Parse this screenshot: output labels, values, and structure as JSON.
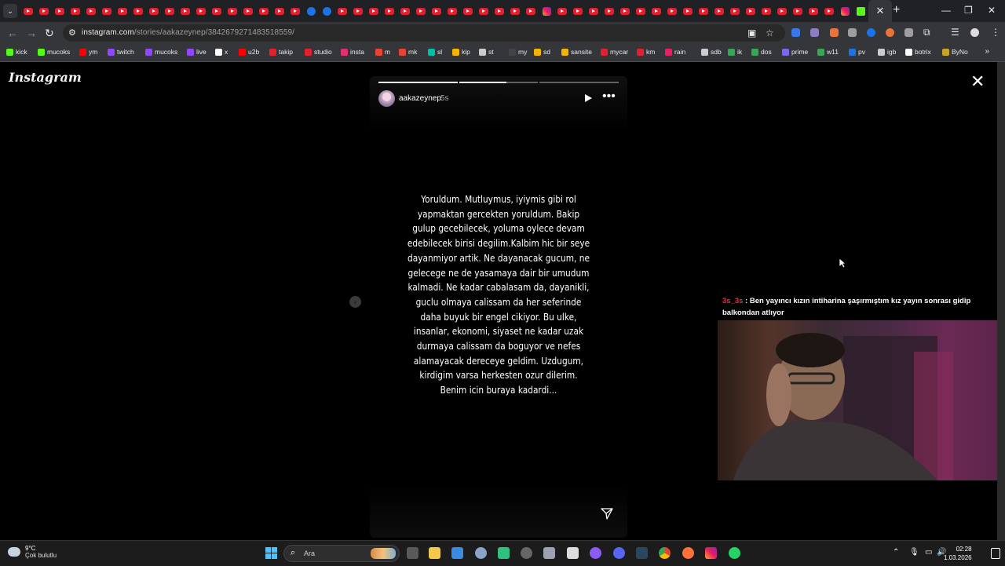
{
  "browser": {
    "active_tab_close": "✕",
    "new_tab": "+",
    "window_controls": {
      "minimize": "—",
      "maximize": "❐",
      "close": "✕"
    },
    "url_host": "instagram.com",
    "url_path": "/stories/aakazeynep/3842679271483518559/"
  },
  "bookmarks": [
    "kick",
    "mucoks",
    "ym",
    "twitch",
    "mucoks",
    "live",
    "x",
    "u2b",
    "takip",
    "studio",
    "insta",
    "m",
    "mk",
    "sl",
    "kip",
    "st",
    "my",
    "sd",
    "sansite",
    "mycar",
    "km",
    "rain",
    "sdb",
    "ik",
    "dos",
    "prime",
    "w11",
    "pv",
    "igb",
    "botrix",
    "ByNo"
  ],
  "bookmark_colors": [
    "#53fc18",
    "#53fc18",
    "#ff0000",
    "#9146ff",
    "#9146ff",
    "#9146ff",
    "#ffffff",
    "#ff0000",
    "#e5202e",
    "#e5202e",
    "#e1306c",
    "#ea4335",
    "#ea4335",
    "#00bfa5",
    "#f4b400",
    "#cccccc",
    "#444444",
    "#f4b400",
    "#f4b400",
    "#e5202e",
    "#e5202e",
    "#e91e63",
    "#cccccc",
    "#34a853",
    "#34a853",
    "#7b68ee",
    "#34a853",
    "#1a73e8",
    "#cccccc",
    "#ffffff",
    "#c9a227"
  ],
  "page": {
    "logo": "Instagram",
    "close_label": "✕",
    "prev_arrow": "‹"
  },
  "story": {
    "username": "aakazeynep",
    "time_ago": "5s",
    "segments": [
      1,
      0.6,
      0
    ],
    "text": "Yoruldum. Mutluymus, iyiymis gibi rol\nyapmaktan gercekten yoruldum. Bakip\ngulup gecebilecek, yoluma oylece devam\nedebilecek birisi degilim.Kalbim hic bir seye\ndayanmiyor artik. Ne dayanacak gucum, ne\ngelecege ne de yasamaya dair bir umudum\nkalmadi. Ne kadar cabalasam da, dayanikli,\nguclu olmaya calissam da her seferinde\ndaha buyuk bir engel cikiyor. Bu ulke,\ninsanlar, ekonomi, siyaset ne kadar uzak\ndurmaya calissam da boguyor ve nefes\nalamayacak dereceye geldim. Uzdugum,\nkirdigim varsa herkesten ozur dilerim.\nBenim icin buraya kadardi..."
  },
  "chat": {
    "user": "3s_3s",
    "separator": " : ",
    "message": "Ben yayıncı kızın intiharina şaşırmıştım kız yayın sonrası gidip balkondan atlıyor"
  },
  "taskbar": {
    "temperature": "9°C",
    "condition": "Çok bulutlu",
    "search_label": "Ara",
    "time": "02:28",
    "date": "1.03.2026"
  }
}
